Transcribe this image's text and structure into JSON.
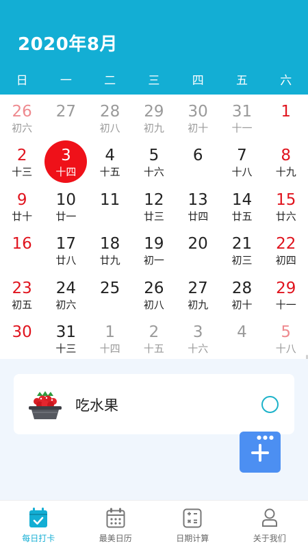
{
  "header": {
    "title": "2020年8月",
    "weekdays": [
      "日",
      "一",
      "二",
      "三",
      "四",
      "五",
      "六"
    ]
  },
  "calendar": {
    "rows": [
      [
        {
          "day": "26",
          "lunar": "初六",
          "month": "prev"
        },
        {
          "day": "27",
          "lunar": "",
          "month": "prev"
        },
        {
          "day": "28",
          "lunar": "初八",
          "month": "prev"
        },
        {
          "day": "29",
          "lunar": "初九",
          "month": "prev"
        },
        {
          "day": "30",
          "lunar": "初十",
          "month": "prev"
        },
        {
          "day": "31",
          "lunar": "十一",
          "month": "prev"
        },
        {
          "day": "1",
          "lunar": "",
          "month": "cur"
        }
      ],
      [
        {
          "day": "2",
          "lunar": "十三",
          "month": "cur"
        },
        {
          "day": "3",
          "lunar": "十四",
          "month": "cur",
          "today": true
        },
        {
          "day": "4",
          "lunar": "十五",
          "month": "cur"
        },
        {
          "day": "5",
          "lunar": "十六",
          "month": "cur"
        },
        {
          "day": "6",
          "lunar": "",
          "month": "cur"
        },
        {
          "day": "7",
          "lunar": "十八",
          "month": "cur"
        },
        {
          "day": "8",
          "lunar": "十九",
          "month": "cur"
        }
      ],
      [
        {
          "day": "9",
          "lunar": "廿十",
          "month": "cur"
        },
        {
          "day": "10",
          "lunar": "廿一",
          "month": "cur"
        },
        {
          "day": "11",
          "lunar": "",
          "month": "cur"
        },
        {
          "day": "12",
          "lunar": "廿三",
          "month": "cur"
        },
        {
          "day": "13",
          "lunar": "廿四",
          "month": "cur"
        },
        {
          "day": "14",
          "lunar": "廿五",
          "month": "cur"
        },
        {
          "day": "15",
          "lunar": "廿六",
          "month": "cur"
        }
      ],
      [
        {
          "day": "16",
          "lunar": "",
          "month": "cur"
        },
        {
          "day": "17",
          "lunar": "廿八",
          "month": "cur"
        },
        {
          "day": "18",
          "lunar": "廿九",
          "month": "cur"
        },
        {
          "day": "19",
          "lunar": "初一",
          "month": "cur"
        },
        {
          "day": "20",
          "lunar": "",
          "month": "cur"
        },
        {
          "day": "21",
          "lunar": "初三",
          "month": "cur"
        },
        {
          "day": "22",
          "lunar": "初四",
          "month": "cur"
        }
      ],
      [
        {
          "day": "23",
          "lunar": "初五",
          "month": "cur"
        },
        {
          "day": "24",
          "lunar": "初六",
          "month": "cur"
        },
        {
          "day": "25",
          "lunar": "",
          "month": "cur"
        },
        {
          "day": "26",
          "lunar": "初八",
          "month": "cur"
        },
        {
          "day": "27",
          "lunar": "初九",
          "month": "cur"
        },
        {
          "day": "28",
          "lunar": "初十",
          "month": "cur"
        },
        {
          "day": "29",
          "lunar": "十一",
          "month": "cur"
        }
      ],
      [
        {
          "day": "30",
          "lunar": "",
          "month": "cur"
        },
        {
          "day": "31",
          "lunar": "十三",
          "month": "cur"
        },
        {
          "day": "1",
          "lunar": "十四",
          "month": "next"
        },
        {
          "day": "2",
          "lunar": "十五",
          "month": "next"
        },
        {
          "day": "3",
          "lunar": "十六",
          "month": "next"
        },
        {
          "day": "4",
          "lunar": "",
          "month": "next"
        },
        {
          "day": "5",
          "lunar": "十八",
          "month": "next"
        }
      ]
    ]
  },
  "checkin": {
    "task_label": "吃水果",
    "task_icon": "fruit-basket-icon",
    "checked": false
  },
  "fab": {
    "icon": "add-icon"
  },
  "tabbar": {
    "tabs": [
      {
        "label": "每日打卡",
        "icon": "calendar-check-icon",
        "active": true
      },
      {
        "label": "最美日历",
        "icon": "calendar-grid-icon",
        "active": false
      },
      {
        "label": "日期计算",
        "icon": "calculator-icon",
        "active": false
      },
      {
        "label": "关于我们",
        "icon": "user-icon",
        "active": false
      }
    ]
  },
  "colors": {
    "header_bg": "#13aed4",
    "today_circle": "#ef1119",
    "weekend_text": "#e0141e",
    "fab_bg": "#4c8ff2",
    "lower_bg": "#f0f6fd"
  }
}
